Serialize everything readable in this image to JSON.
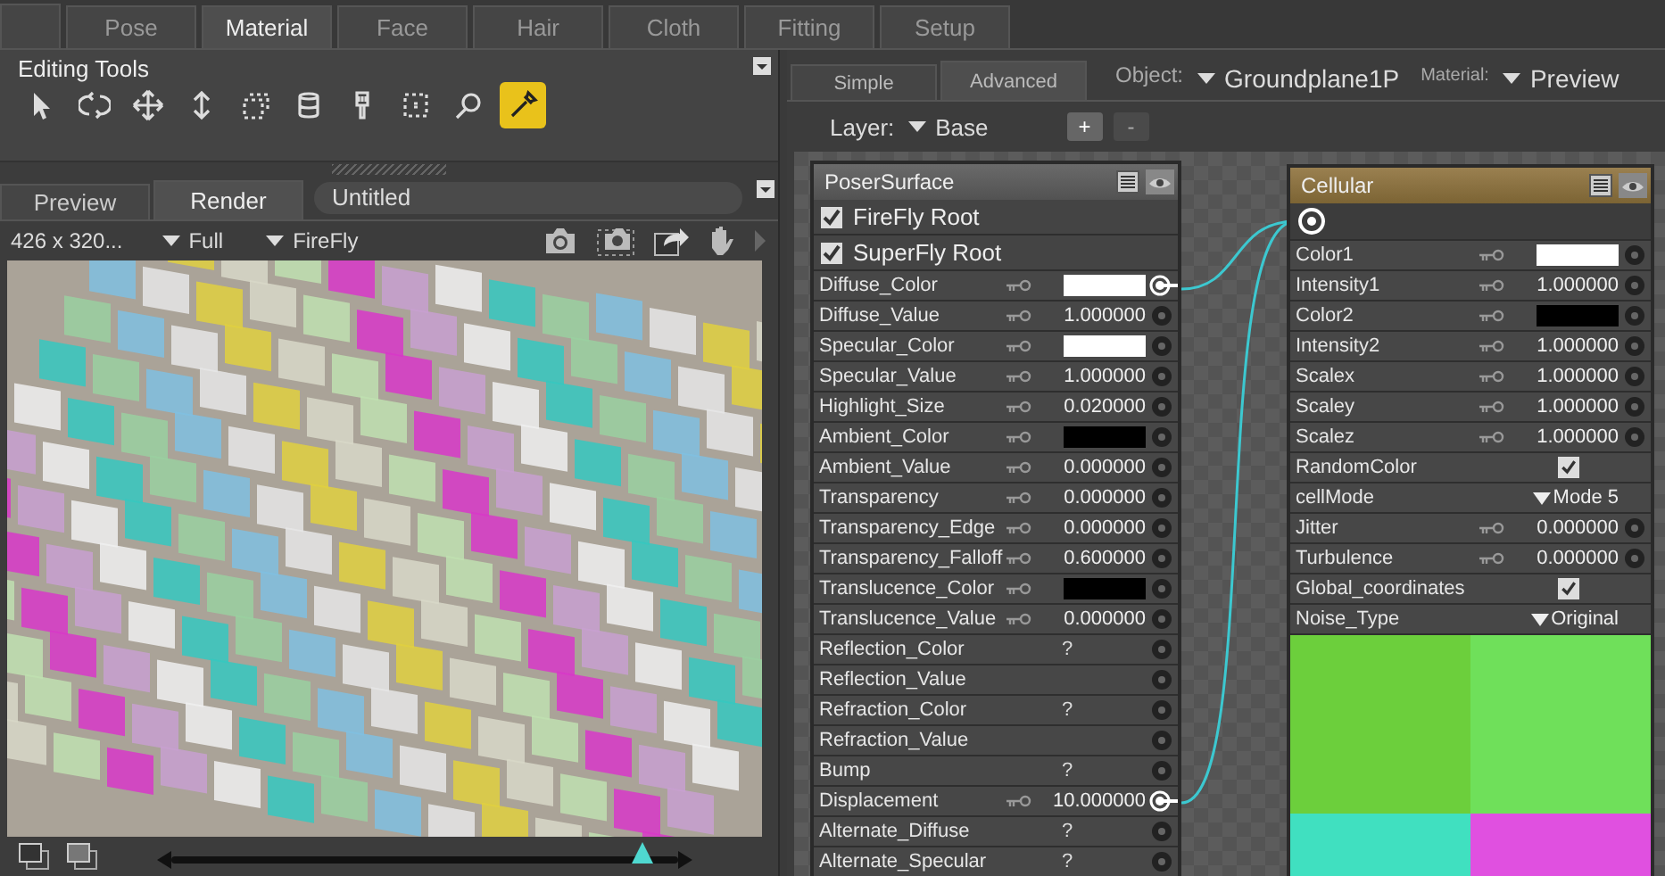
{
  "main_tabs": [
    {
      "label": "Pose",
      "selected": false
    },
    {
      "label": "Material",
      "selected": true
    },
    {
      "label": "Face",
      "selected": false
    },
    {
      "label": "Hair",
      "selected": false
    },
    {
      "label": "Cloth",
      "selected": false
    },
    {
      "label": "Fitting",
      "selected": false
    },
    {
      "label": "Setup",
      "selected": false
    }
  ],
  "editing_tools": {
    "title": "Editing Tools",
    "tools": [
      {
        "kind": "arrow",
        "selected": false
      },
      {
        "kind": "rotate",
        "selected": false
      },
      {
        "kind": "move",
        "selected": false
      },
      {
        "kind": "updown",
        "selected": false
      },
      {
        "kind": "frame",
        "selected": false
      },
      {
        "kind": "stack",
        "selected": false
      },
      {
        "kind": "brush",
        "selected": false
      },
      {
        "kind": "dots",
        "selected": false
      },
      {
        "kind": "search",
        "selected": false
      },
      {
        "kind": "eyedropper",
        "selected": true
      }
    ]
  },
  "preview_panel": {
    "tabs": [
      {
        "label": "Preview",
        "selected": false
      },
      {
        "label": "Render",
        "selected": true
      }
    ],
    "title": "Untitled",
    "resolution": "426 x 320...",
    "quality": "Full",
    "renderer": "FireFly",
    "zoom_slider": {
      "level": 0.93
    }
  },
  "material_room": {
    "tabs": [
      {
        "label": "Simple",
        "selected": false
      },
      {
        "label": "Advanced",
        "selected": true
      }
    ],
    "object_label": "Object:",
    "object": "Groundplane1P",
    "material_label": "Material:",
    "material": "Preview",
    "layer_label": "Layer:",
    "layer": "Base",
    "add_button": "+",
    "remove_button": {
      "label": "-",
      "disabled": true
    }
  },
  "nodes": [
    {
      "title": "PoserSurface",
      "kind": "root",
      "roots": [
        {
          "label": "FireFly Root",
          "checked": true
        },
        {
          "label": "SuperFly Root",
          "checked": true
        }
      ],
      "params": [
        {
          "name": "Diffuse_Color",
          "kind": "color",
          "color": "#ffffff",
          "connected": true
        },
        {
          "name": "Diffuse_Value",
          "kind": "value",
          "value": "1.000000",
          "connected": false
        },
        {
          "name": "Specular_Color",
          "kind": "color",
          "color": "#ffffff",
          "connected": false
        },
        {
          "name": "Specular_Value",
          "kind": "value",
          "value": "1.000000",
          "connected": false
        },
        {
          "name": "Highlight_Size",
          "kind": "value",
          "value": "0.020000",
          "connected": false
        },
        {
          "name": "Ambient_Color",
          "kind": "color",
          "color": "#000000",
          "connected": false
        },
        {
          "name": "Ambient_Value",
          "kind": "value",
          "value": "0.000000",
          "connected": false
        },
        {
          "name": "Transparency",
          "kind": "value",
          "value": "0.000000",
          "connected": false
        },
        {
          "name": "Transparency_Edge",
          "kind": "value",
          "value": "0.000000",
          "connected": false
        },
        {
          "name": "Transparency_Falloff",
          "kind": "value",
          "value": "0.600000",
          "connected": false
        },
        {
          "name": "Translucence_Color",
          "kind": "color",
          "color": "#000000",
          "connected": false
        },
        {
          "name": "Translucence_Value",
          "kind": "value",
          "value": "0.000000",
          "connected": false
        },
        {
          "name": "Reflection_Color",
          "kind": "unknown",
          "value": "?",
          "connected": false
        },
        {
          "name": "Reflection_Value",
          "kind": "none",
          "connected": false
        },
        {
          "name": "Refraction_Color",
          "kind": "unknown",
          "value": "?",
          "connected": false
        },
        {
          "name": "Refraction_Value",
          "kind": "none",
          "connected": false
        },
        {
          "name": "Bump",
          "kind": "unknown",
          "value": "?",
          "connected": false
        },
        {
          "name": "Displacement",
          "kind": "value",
          "value": "10.000000",
          "connected": true
        },
        {
          "name": "Alternate_Diffuse",
          "kind": "unknown",
          "value": "?",
          "connected": false
        },
        {
          "name": "Alternate_Specular",
          "kind": "unknown",
          "value": "?",
          "connected": false
        }
      ]
    },
    {
      "title": "Cellular",
      "kind": "texture",
      "params": [
        {
          "name": "Color1",
          "kind": "color",
          "color": "#ffffff",
          "connected": false
        },
        {
          "name": "Intensity1",
          "kind": "value",
          "value": "1.000000",
          "connected": false
        },
        {
          "name": "Color2",
          "kind": "color",
          "color": "#000000",
          "connected": false
        },
        {
          "name": "Intensity2",
          "kind": "value",
          "value": "1.000000",
          "connected": false
        },
        {
          "name": "Scalex",
          "kind": "value",
          "value": "1.000000",
          "connected": false
        },
        {
          "name": "Scaley",
          "kind": "value",
          "value": "1.000000",
          "connected": false
        },
        {
          "name": "Scalez",
          "kind": "value",
          "value": "1.000000",
          "connected": false
        },
        {
          "name": "RandomColor",
          "kind": "check",
          "checked": true
        },
        {
          "name": "cellMode",
          "kind": "menu",
          "value": "Mode 5"
        },
        {
          "name": "Jitter",
          "kind": "value",
          "value": "0.000000",
          "connected": false
        },
        {
          "name": "Turbulence",
          "kind": "value",
          "value": "0.000000",
          "connected": false
        },
        {
          "name": "Global_coordinates",
          "kind": "check",
          "checked": true
        },
        {
          "name": "Noise_Type",
          "kind": "menu",
          "value": "Original"
        }
      ]
    }
  ]
}
